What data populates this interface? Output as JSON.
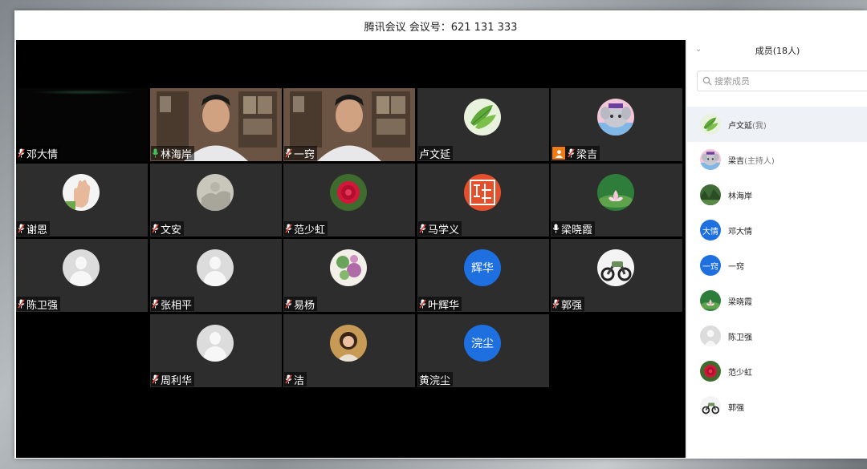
{
  "window": {
    "title": "腾讯会议 会议号：621 131 333"
  },
  "participants": [
    {
      "name": "邓大情",
      "mic": "muted",
      "style": "dark"
    },
    {
      "name": "林海岸",
      "mic": "active",
      "style": "video"
    },
    {
      "name": "一窍",
      "mic": "muted",
      "style": "video"
    },
    {
      "name": "卢文延",
      "mic": "none",
      "style": "avatar",
      "avatar": "tea-leaf-avatar"
    },
    {
      "name": "梁吉",
      "mic": "muted",
      "style": "avatar",
      "host": true,
      "avatar": "cartoon-avatar"
    },
    {
      "name": "谢恩",
      "mic": "muted",
      "style": "avatar",
      "avatar": "hand-avatar"
    },
    {
      "name": "文安",
      "mic": "muted",
      "style": "avatar",
      "avatar": "painting-avatar"
    },
    {
      "name": "范少虹",
      "mic": "muted",
      "style": "avatar",
      "avatar": "red-flower-avatar"
    },
    {
      "name": "马学义",
      "mic": "muted",
      "style": "avatar",
      "avatar": "seal-avatar"
    },
    {
      "name": "梁晓霞",
      "mic": "unmuted",
      "style": "avatar",
      "avatar": "lotus-avatar"
    },
    {
      "name": "陈卫强",
      "mic": "muted",
      "style": "avatar",
      "avatar": "default-person-avatar"
    },
    {
      "name": "张相平",
      "mic": "muted",
      "style": "avatar",
      "avatar": "default-person-avatar"
    },
    {
      "name": "易杨",
      "mic": "muted",
      "style": "avatar",
      "avatar": "succulent-avatar"
    },
    {
      "name": "叶辉华",
      "mic": "muted",
      "style": "avatar",
      "avatar_text": "辉华"
    },
    {
      "name": "郭强",
      "mic": "muted",
      "style": "avatar",
      "avatar": "motorcycle-avatar"
    },
    {
      "name": "周利华",
      "mic": "muted",
      "style": "avatar",
      "avatar": "default-person-avatar"
    },
    {
      "name": "洁",
      "mic": "muted",
      "style": "avatar",
      "avatar": "woman-photo-avatar"
    },
    {
      "name": "黄浣尘",
      "mic": "none",
      "style": "avatar",
      "avatar_text": "浣尘"
    }
  ],
  "sidebar": {
    "members_title": "成员(18人)",
    "search_placeholder": "搜索成员",
    "members": [
      {
        "name": "卢文延",
        "role": "(我)",
        "avatar": "tea-leaf-avatar"
      },
      {
        "name": "梁吉",
        "role": "(主持人)",
        "avatar": "cartoon-avatar"
      },
      {
        "name": "林海岸",
        "role": "",
        "avatar": "forest-avatar"
      },
      {
        "name": "邓大情",
        "role": "",
        "avatar_text": "大情"
      },
      {
        "name": "一窍",
        "role": "",
        "avatar_text": "一窍"
      },
      {
        "name": "梁晓霞",
        "role": "",
        "avatar": "lotus-avatar"
      },
      {
        "name": "陈卫强",
        "role": "",
        "avatar": "default-person-avatar"
      },
      {
        "name": "范少虹",
        "role": "",
        "avatar": "red-flower-avatar"
      },
      {
        "name": "郭强",
        "role": "",
        "avatar": "motorcycle-avatar"
      }
    ]
  },
  "colors": {
    "accent_blue": "#1e6fe0",
    "host_orange": "#f07c17",
    "mic_active": "#43c35a",
    "mic_muted": "#e0443a"
  }
}
